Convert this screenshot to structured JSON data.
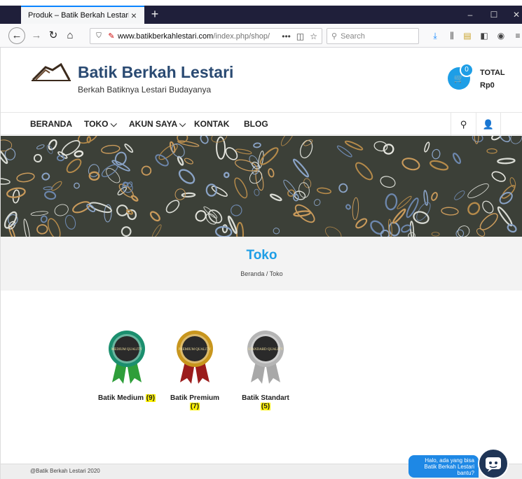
{
  "browser": {
    "tab_title": "Produk – Batik Berkah Lestari",
    "tab_close": "×",
    "new_tab": "+",
    "url_domain": "www.batikberkahlestari.com",
    "url_path": "/index.php/shop/",
    "url_more": "•••",
    "search_placeholder": "Search",
    "window_controls": [
      "–",
      "☐",
      "✕"
    ]
  },
  "site": {
    "title": "Batik Berkah Lestari",
    "tagline": "Berkah Batiknya Lestari Budayanya",
    "cart_count": "0",
    "total_label": "TOTAL",
    "total_value": "Rp0"
  },
  "menu": {
    "items": [
      {
        "label": "BERANDA"
      },
      {
        "label": "TOKO ⌵"
      },
      {
        "label": "AKUN SAYA ⌵"
      },
      {
        "label": "KONTAK"
      },
      {
        "label": "BLOG"
      }
    ]
  },
  "page": {
    "title": "Toko",
    "breadcrumb": "Beranda / Toko"
  },
  "categories": [
    {
      "name": "Batik Medium",
      "count": "(9)",
      "badge_text": "MEDIUM QUALITY",
      "color": "#1b8f6e",
      "ribbon": "#2e9e3a"
    },
    {
      "name": "Batik Premium",
      "count": "(7)",
      "badge_text": "PREMIUM QUALITY",
      "color": "#c8961e",
      "ribbon": "#9b1c1c"
    },
    {
      "name": "Batik Standart",
      "count": "(5)",
      "badge_text": "STANDARD QUALITY",
      "color": "#b5b5b5",
      "ribbon": "#a8a8a8"
    }
  ],
  "footer": {
    "copyright": "@Batik Berkah Lestari 2020"
  },
  "chat": {
    "message": "Halo, ada yang bisa Batik Berkah Lestari bantu?"
  },
  "colors": {
    "accent": "#1e9ee6",
    "brand_title": "#2a4a72",
    "tabbar": "#1f1f3a"
  }
}
